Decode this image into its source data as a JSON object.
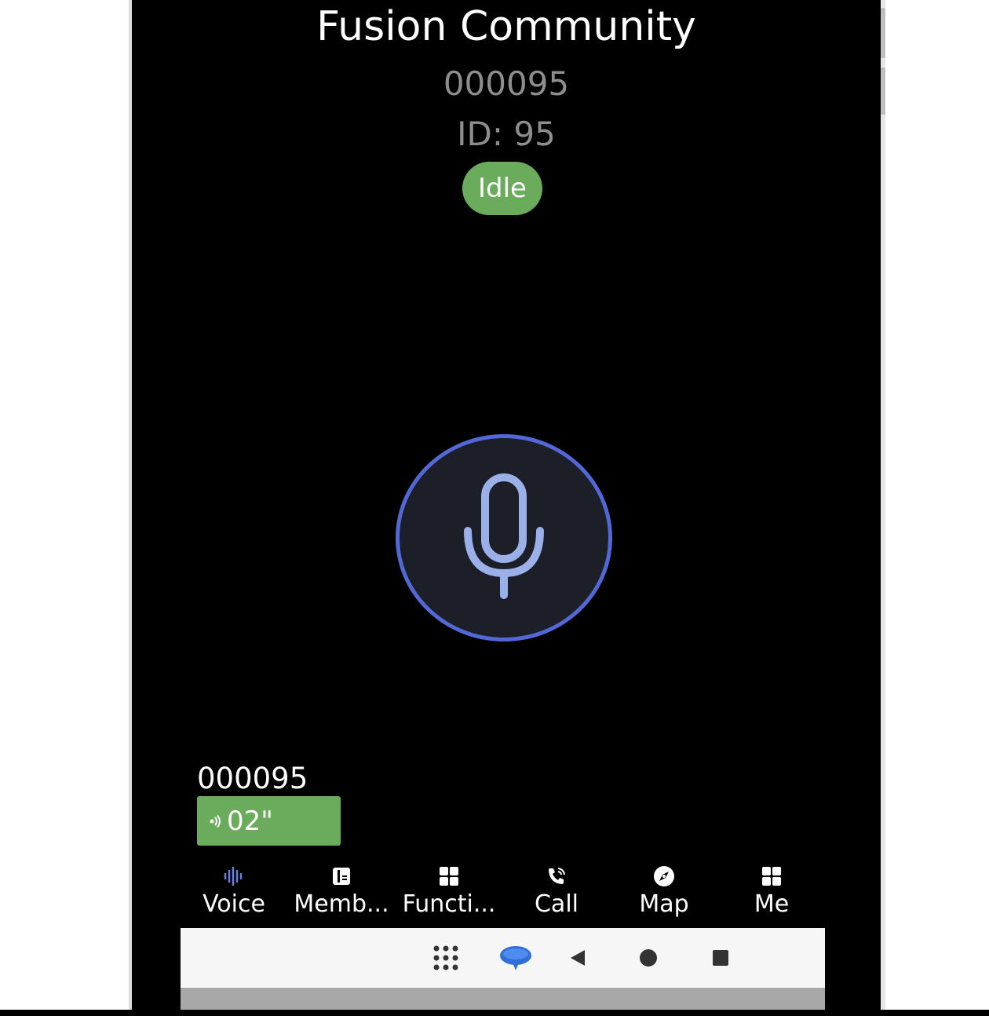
{
  "header": {
    "title": "Fusion Community",
    "group_number": "000095",
    "group_id": "ID: 95",
    "status": "Idle"
  },
  "ptt": {
    "icon": "microphone-icon",
    "ring_color": "#5268d6"
  },
  "last_message": {
    "speaker": "000095",
    "duration": "02\"",
    "icon": "speaker-wave-icon"
  },
  "tabs": [
    {
      "label": "Voice",
      "icon": "voice-waveform-icon",
      "active": true
    },
    {
      "label": "Memb...",
      "icon": "members-book-icon",
      "active": false
    },
    {
      "label": "Functi...",
      "icon": "function-grid-icon",
      "active": false
    },
    {
      "label": "Call",
      "icon": "phone-call-icon",
      "active": false
    },
    {
      "label": "Map",
      "icon": "compass-icon",
      "active": false
    },
    {
      "label": "Me",
      "icon": "grid-icon",
      "active": false
    }
  ],
  "colors": {
    "accent": "#5268d6",
    "status_green": "#6aac5c",
    "background": "#000000"
  },
  "system_nav": {
    "items": [
      "apps-grid-icon",
      "chat-bubble-icon",
      "back-icon",
      "home-icon",
      "recents-icon"
    ]
  }
}
